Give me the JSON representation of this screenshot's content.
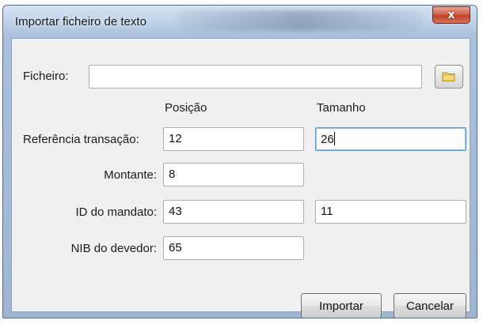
{
  "window": {
    "title": "Importar ficheiro de texto",
    "close_symbol": "x"
  },
  "file": {
    "label": "Ficheiro:",
    "value": "",
    "browse_icon": "folder-icon"
  },
  "columns": {
    "position": "Posição",
    "size": "Tamanho"
  },
  "rows": [
    {
      "label": "Referência transação:",
      "position": "12",
      "size": "26"
    },
    {
      "label": "Montante:",
      "position": "8"
    },
    {
      "label": "ID do mandato:",
      "position": "43",
      "size": "11"
    },
    {
      "label": "NIB do devedor:",
      "position": "65"
    }
  ],
  "buttons": {
    "import": "Importar",
    "cancel": "Cancelar"
  },
  "colors": {
    "close_button": "#c0412a",
    "focus_border": "#5b9bd8",
    "folder": "#e8c04a"
  }
}
